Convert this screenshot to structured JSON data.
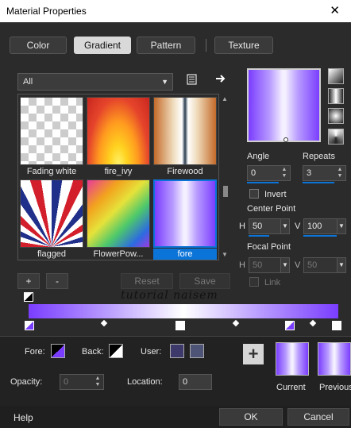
{
  "window": {
    "title": "Material Properties",
    "close": "✕"
  },
  "tabs": [
    {
      "label": "Color",
      "active": false
    },
    {
      "label": "Gradient",
      "active": true
    },
    {
      "label": "Pattern",
      "active": false
    },
    {
      "label": "Texture",
      "active": false
    }
  ],
  "library": {
    "category": "All",
    "items": [
      {
        "label": "Fading white"
      },
      {
        "label": "fire_ivy"
      },
      {
        "label": "Firewood"
      },
      {
        "label": "flagged"
      },
      {
        "label": "FlowerPow..."
      },
      {
        "label": "fore",
        "selected": true
      }
    ],
    "add": "+",
    "remove": "-",
    "reset": "Reset",
    "save": "Save"
  },
  "params": {
    "angle_label": "Angle",
    "angle_value": "0",
    "repeats_label": "Repeats",
    "repeats_value": "3",
    "invert_label": "Invert",
    "center_label": "Center Point",
    "h_label": "H",
    "v_label": "V",
    "center_h": "50",
    "center_v": "100",
    "focal_label": "Focal Point",
    "focal_h": "50",
    "focal_v": "50",
    "link_label": "Link"
  },
  "watermark": "tutorial naisem",
  "colors": {
    "fore_label": "Fore:",
    "back_label": "Back:",
    "user_label": "User:",
    "user1": "#3d3a6b",
    "user2": "#4d5475",
    "accent": "#0b74d8",
    "gradient_start": "#7a3dff"
  },
  "stopfields": {
    "opacity_label": "Opacity:",
    "opacity_value": "0",
    "location_label": "Location:",
    "location_value": "0"
  },
  "previews": {
    "current": "Current",
    "previous": "Previous",
    "plus": "+"
  },
  "footer": {
    "help": "Help",
    "ok": "OK",
    "cancel": "Cancel"
  }
}
